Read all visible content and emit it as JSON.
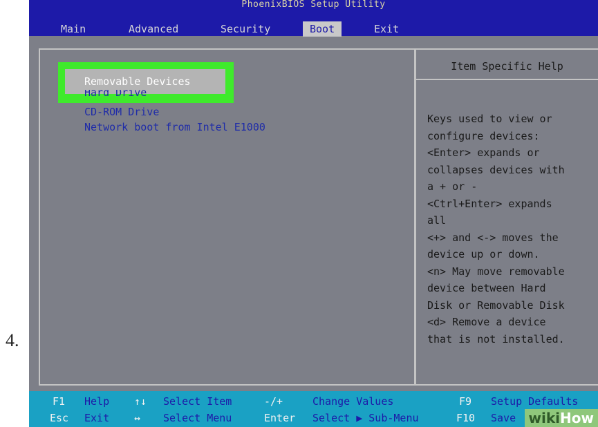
{
  "step_number": "4.",
  "bios": {
    "title": "PhoenixBIOS Setup Utility",
    "menu": [
      {
        "label": "Main",
        "active": false
      },
      {
        "label": "Advanced",
        "active": false
      },
      {
        "label": "Security",
        "active": false
      },
      {
        "label": "Boot",
        "active": true
      },
      {
        "label": "Exit",
        "active": false
      }
    ],
    "boot_items": [
      {
        "label": "Removable Devices",
        "selected": true
      },
      {
        "label": "Hard Drive",
        "selected": false,
        "partially_hidden": true
      },
      {
        "label": "CD-ROM Drive",
        "selected": false
      },
      {
        "label": "Network boot from Intel E1000",
        "selected": false
      }
    ],
    "help_title": "Item Specific Help",
    "help_text": "Keys used to view or\nconfigure devices:\n<Enter> expands or\ncollapses devices with\na + or -\n<Ctrl+Enter> expands\nall\n<+> and <-> moves the\ndevice up or down.\n<n> May move removable\ndevice between Hard\nDisk or Removable Disk\n<d> Remove a device\nthat is not installed.",
    "footer": {
      "row1": [
        {
          "key": "F1",
          "desc": "Help"
        },
        {
          "key": "↑↓",
          "desc": "Select Item"
        },
        {
          "key": "-/+",
          "desc": "Change Values"
        },
        {
          "key": "F9",
          "desc": "Setup Defaults"
        }
      ],
      "row2": [
        {
          "key": "Esc",
          "desc": "Exit"
        },
        {
          "key": "↔",
          "desc": "Select Menu"
        },
        {
          "key": "Enter",
          "desc": "Select ▶ Sub-Menu"
        },
        {
          "key": "F10",
          "desc": "Save"
        }
      ]
    }
  },
  "watermark": {
    "part1": "wiki",
    "part2": "How"
  },
  "colors": {
    "bios_blue": "#1d1aa8",
    "bios_gray": "#7d7f88",
    "footer_cyan": "#1aa1c4",
    "highlight_green": "#3fea2c"
  }
}
